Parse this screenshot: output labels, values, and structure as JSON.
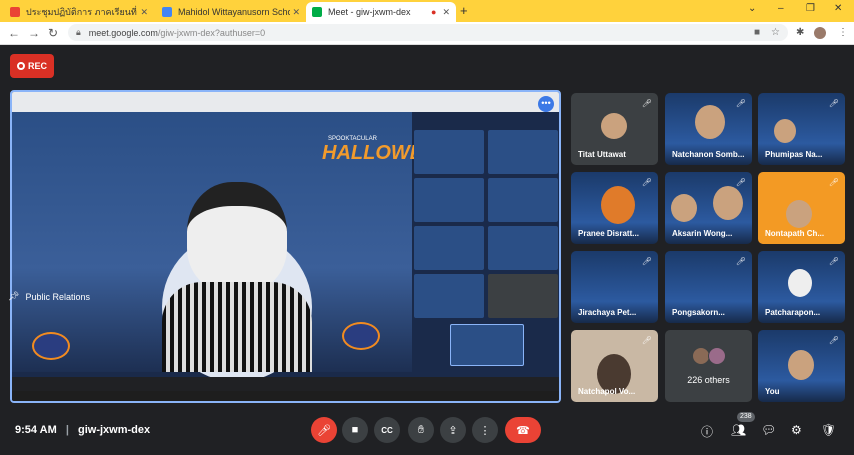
{
  "browser": {
    "tabs": [
      {
        "label": "ประชุมปฏิบัติการ ภาคเรียนที่ 2 ปีการศึ",
        "icon": "gmail-icon",
        "active": false
      },
      {
        "label": "Mahidol Wittayanusorn School",
        "icon": "school-icon",
        "active": false
      },
      {
        "label": "Meet - giw-jxwm-dex",
        "icon": "meet-icon",
        "active": true
      }
    ],
    "new_tab": "+",
    "window_controls": [
      "⌄",
      "–",
      "❐",
      "✕"
    ],
    "url_host": "meet.google.com",
    "url_path": "/giw-jxwm-dex?authuser=0"
  },
  "meet": {
    "rec_label": "REC",
    "presenter_label": "Public Relations",
    "share_content": {
      "banner_small": "SPOOKTACULAR",
      "banner_big": "HALLOWEEN"
    },
    "participants": [
      {
        "name": "Titat Uttawat",
        "muted": true,
        "bg": "#3c4043"
      },
      {
        "name": "Natchanon Somb...",
        "muted": true,
        "bg": "halloween"
      },
      {
        "name": "Phumipas Na...",
        "muted": true,
        "bg": "halloween"
      },
      {
        "name": "Pranee Disratt...",
        "muted": true,
        "bg": "halloween"
      },
      {
        "name": "Aksarin Wong...",
        "muted": true,
        "bg": "halloween"
      },
      {
        "name": "Nontapath Ch...",
        "muted": true,
        "bg": "orange"
      },
      {
        "name": "Jirachaya Pet...",
        "muted": true,
        "bg": "halloween"
      },
      {
        "name": "Pongsakorn...",
        "muted": true,
        "bg": "halloween"
      },
      {
        "name": "Patcharapon...",
        "muted": true,
        "bg": "halloween"
      },
      {
        "name": "Natchapol Vo...",
        "muted": true,
        "bg": "room"
      },
      {
        "name": "226 others",
        "muted": false,
        "bg": "#3c4043"
      },
      {
        "name": "You",
        "muted": true,
        "bg": "halloween"
      }
    ],
    "bottom": {
      "time": "9:54 AM",
      "separator": "|",
      "meeting_code": "giw-jxwm-dex",
      "participant_count": "238"
    }
  },
  "colors": {
    "tabbar": "#ffd23c",
    "meet_bg": "#202124",
    "rec_red": "#d93025",
    "accent_blue": "#8ab4f8"
  }
}
